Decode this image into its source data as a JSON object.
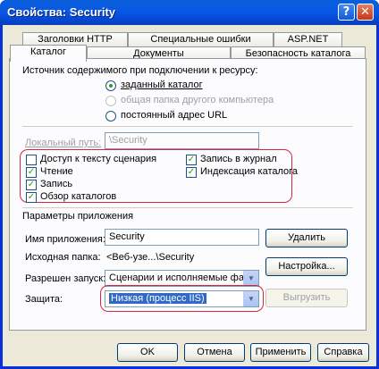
{
  "window": {
    "title": "Свойства: Security"
  },
  "titlebar": {
    "help_glyph": "?",
    "close_glyph": "✕"
  },
  "tabs": {
    "row_top": [
      "Заголовки HTTP",
      "Специальные ошибки",
      "ASP.NET"
    ],
    "row_bottom": [
      "Каталог",
      "Документы",
      "Безопасность каталога"
    ],
    "active": "Каталог"
  },
  "source": {
    "heading": "Источник содержимого при подключении к ресурсу:",
    "options": [
      {
        "label": "заданный каталог",
        "checked": true,
        "disabled": false
      },
      {
        "label": "общая папка другого компьютера",
        "checked": false,
        "disabled": true
      },
      {
        "label": "постоянный адрес URL",
        "checked": false,
        "disabled": false
      }
    ]
  },
  "local_path": {
    "label": "Локальный путь:",
    "value": "\\Security"
  },
  "permissions": [
    {
      "label": "Доступ к тексту сценария",
      "checked": false
    },
    {
      "label": "Чтение",
      "checked": true
    },
    {
      "label": "Запись",
      "checked": true
    },
    {
      "label": "Обзор каталогов",
      "checked": true
    },
    {
      "label": "Запись в журнал",
      "checked": true
    },
    {
      "label": "Индексация каталога",
      "checked": true
    }
  ],
  "app": {
    "heading": "Параметры приложения",
    "name_label": "Имя приложения:",
    "name_value": "Security",
    "folder_label": "Исходная папка:",
    "folder_value": "<Веб-узе...\\Security",
    "exec_label": "Разрешен запуск:",
    "exec_value": "Сценарии и исполняемые файлы",
    "protect_label": "Защита:",
    "protect_value": "Низкая (процесс IIS)",
    "btn_delete": "Удалить",
    "btn_config": "Настройка...",
    "btn_unload": "Выгрузить"
  },
  "footer": {
    "ok": "OK",
    "cancel": "Отмена",
    "apply": "Применить",
    "help": "Справка"
  },
  "colors": {
    "titlebar": "#0a5fd8",
    "highlight_box": "#d6263f",
    "selection": "#316ac5",
    "check_mark": "#21a121"
  }
}
